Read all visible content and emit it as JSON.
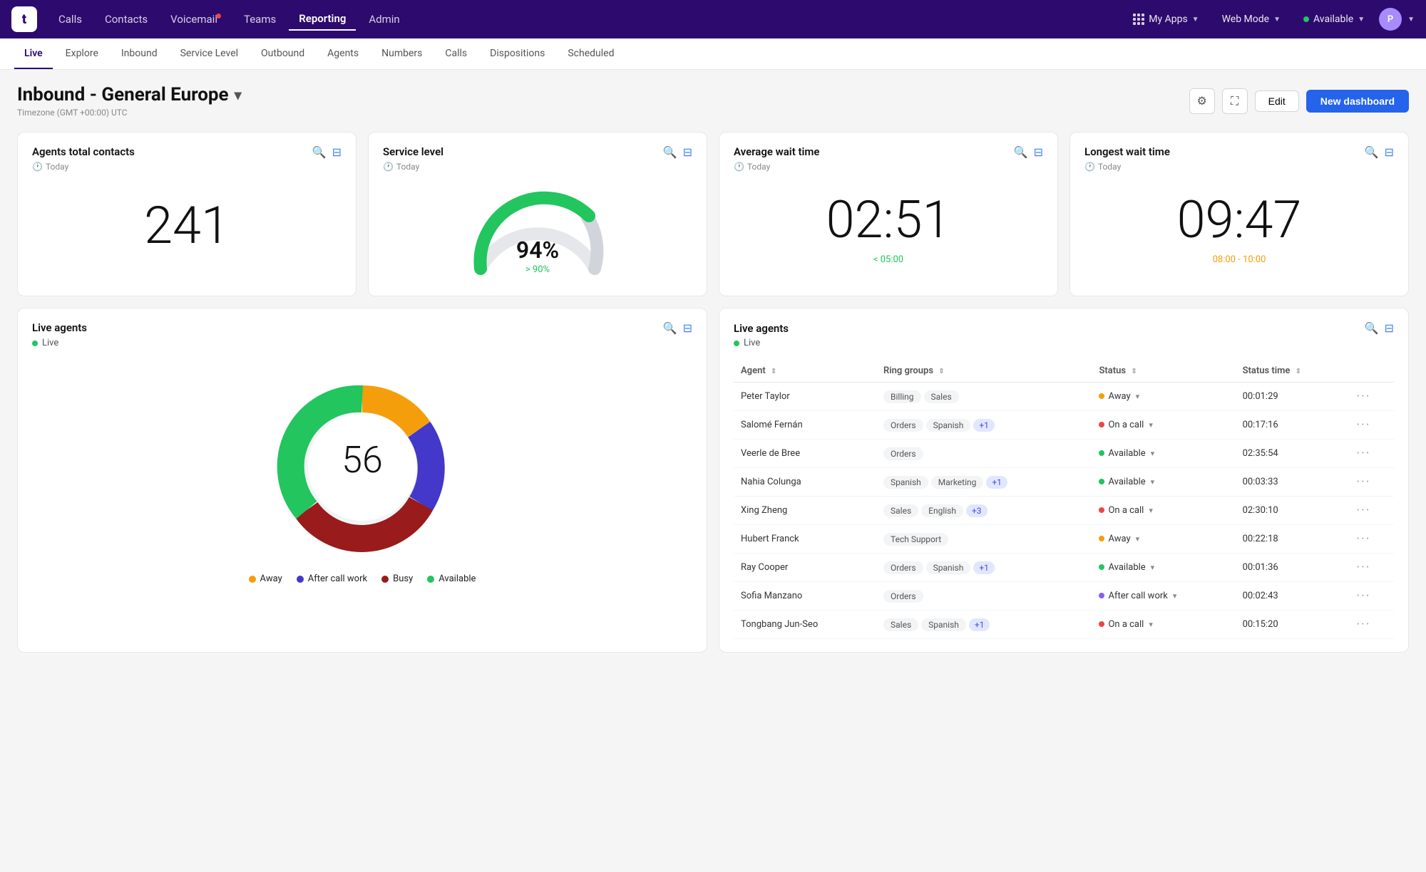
{
  "app": {
    "logo": "t",
    "nav": {
      "items": [
        {
          "label": "Calls",
          "active": false
        },
        {
          "label": "Contacts",
          "active": false
        },
        {
          "label": "Voicemail",
          "active": false,
          "badge": true
        },
        {
          "label": "Teams",
          "active": false
        },
        {
          "label": "Reporting",
          "active": true
        },
        {
          "label": "Admin",
          "active": false
        }
      ]
    },
    "right_nav": {
      "my_apps": "My Apps",
      "web_mode": "Web Mode",
      "status": "Available"
    }
  },
  "sub_nav": {
    "items": [
      {
        "label": "Live",
        "active": true
      },
      {
        "label": "Explore",
        "active": false
      },
      {
        "label": "Inbound",
        "active": false
      },
      {
        "label": "Service Level",
        "active": false
      },
      {
        "label": "Outbound",
        "active": false
      },
      {
        "label": "Agents",
        "active": false
      },
      {
        "label": "Numbers",
        "active": false
      },
      {
        "label": "Calls",
        "active": false
      },
      {
        "label": "Dispositions",
        "active": false
      },
      {
        "label": "Scheduled",
        "active": false
      }
    ]
  },
  "dashboard": {
    "title": "Inbound - General Europe",
    "timezone": "Timezone (GMT +00:00) UTC",
    "edit_label": "Edit",
    "new_dashboard_label": "New dashboard"
  },
  "cards": {
    "agents_total": {
      "title": "Agents total contacts",
      "subtitle": "Today",
      "value": "241"
    },
    "service_level": {
      "title": "Service level",
      "subtitle": "Today",
      "gauge_value": "94%",
      "gauge_threshold": "> 90%",
      "gauge_percent": 94
    },
    "avg_wait": {
      "title": "Average wait time",
      "subtitle": "Today",
      "value": "02:51",
      "sub": "< 05:00",
      "sub_color": "green"
    },
    "longest_wait": {
      "title": "Longest wait time",
      "subtitle": "Today",
      "value": "09:47",
      "sub": "08:00 - 10:00",
      "sub_color": "yellow"
    }
  },
  "live_agents_donut": {
    "title": "Live agents",
    "live_label": "Live",
    "total": "56",
    "segments": [
      {
        "label": "Away",
        "color": "#f59e0b",
        "percent": 18
      },
      {
        "label": "After call work",
        "color": "#4338ca",
        "percent": 15
      },
      {
        "label": "Busy",
        "color": "#991b1b",
        "percent": 40
      },
      {
        "label": "Available",
        "color": "#22c55e",
        "percent": 27
      }
    ]
  },
  "live_agents_table": {
    "title": "Live agents",
    "live_label": "Live",
    "columns": [
      {
        "label": "Agent",
        "sort": true
      },
      {
        "label": "Ring groups",
        "sort": true
      },
      {
        "label": "Status",
        "sort": true
      },
      {
        "label": "Status time",
        "sort": true
      }
    ],
    "rows": [
      {
        "agent": "Peter Taylor",
        "ring_groups": [
          "Billing",
          "Sales"
        ],
        "ring_groups_more": 0,
        "status": "Away",
        "status_dot": "yellow",
        "status_time": "00:01:29"
      },
      {
        "agent": "Salomé Fernán",
        "ring_groups": [
          "Orders",
          "Spanish"
        ],
        "ring_groups_more": 1,
        "status": "On a call",
        "status_dot": "red",
        "status_time": "00:17:16"
      },
      {
        "agent": "Veerle de Bree",
        "ring_groups": [
          "Orders"
        ],
        "ring_groups_more": 0,
        "status": "Available",
        "status_dot": "green",
        "status_time": "02:35:54"
      },
      {
        "agent": "Nahia Colunga",
        "ring_groups": [
          "Spanish",
          "Marketing"
        ],
        "ring_groups_more": 1,
        "status": "Available",
        "status_dot": "green",
        "status_time": "00:03:33"
      },
      {
        "agent": "Xing Zheng",
        "ring_groups": [
          "Sales",
          "English"
        ],
        "ring_groups_more": 3,
        "status": "On a call",
        "status_dot": "red",
        "status_time": "02:30:10"
      },
      {
        "agent": "Hubert Franck",
        "ring_groups": [
          "Tech Support"
        ],
        "ring_groups_more": 0,
        "status": "Away",
        "status_dot": "yellow",
        "status_time": "00:22:18"
      },
      {
        "agent": "Ray Cooper",
        "ring_groups": [
          "Orders",
          "Spanish"
        ],
        "ring_groups_more": 1,
        "status": "Available",
        "status_dot": "green",
        "status_time": "00:01:36"
      },
      {
        "agent": "Sofia Manzano",
        "ring_groups": [
          "Orders"
        ],
        "ring_groups_more": 0,
        "status": "After call work",
        "status_dot": "purple",
        "status_time": "00:02:43"
      },
      {
        "agent": "Tongbang Jun-Seo",
        "ring_groups": [
          "Sales",
          "Spanish"
        ],
        "ring_groups_more": 1,
        "status": "On a call",
        "status_dot": "red",
        "status_time": "00:15:20"
      }
    ]
  }
}
